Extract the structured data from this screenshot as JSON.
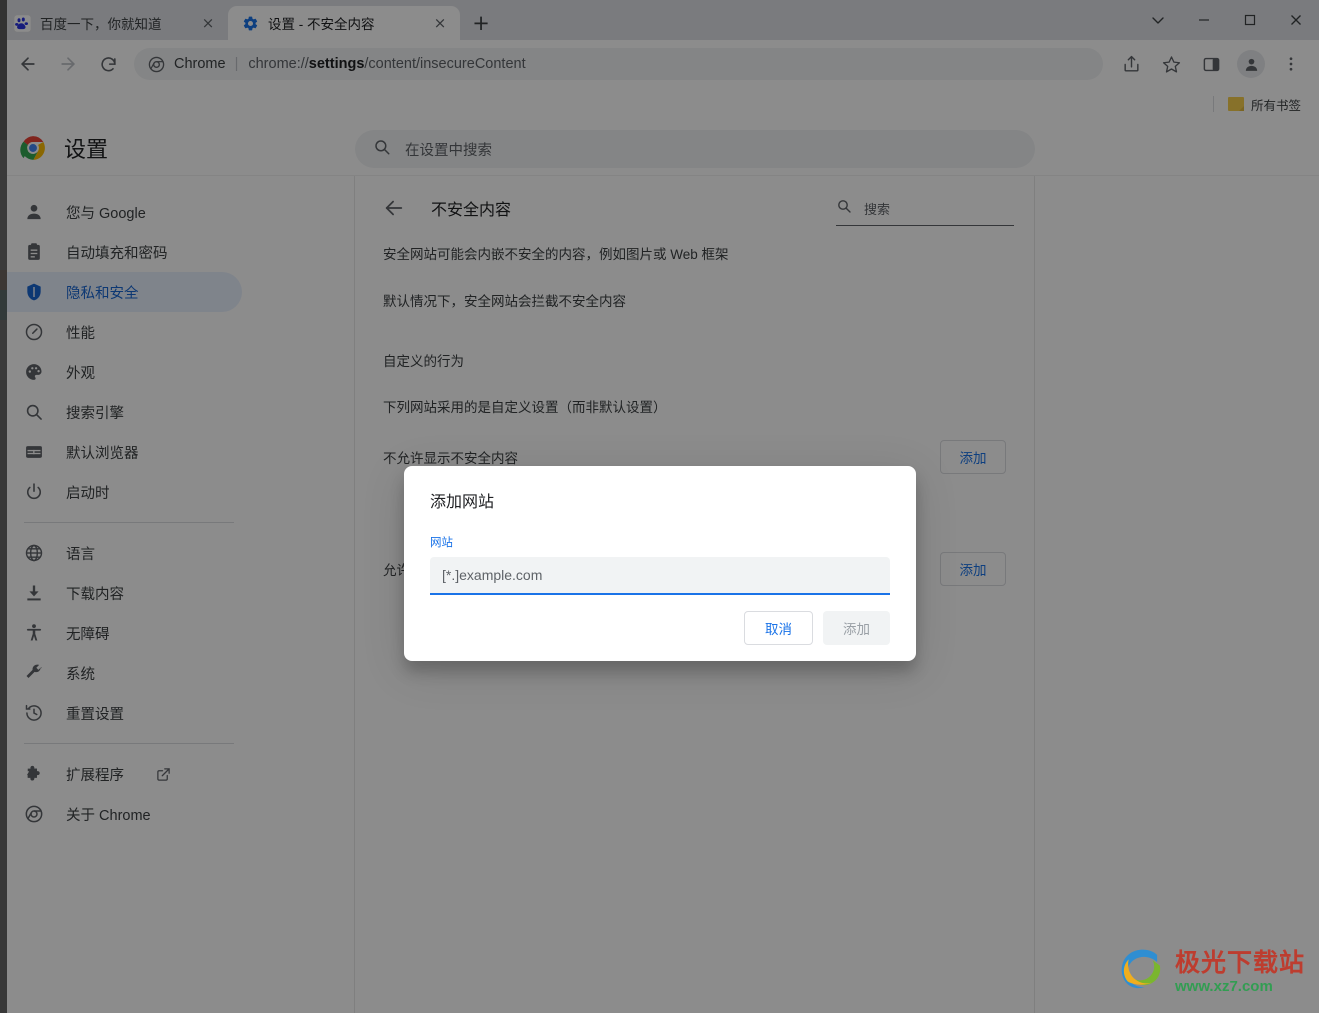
{
  "window": {
    "controls": [
      {
        "name": "tab-search",
        "glyph": "chevron-down"
      },
      {
        "name": "minimize",
        "glyph": "minimize"
      },
      {
        "name": "maximize",
        "glyph": "maximize"
      },
      {
        "name": "close",
        "glyph": "close"
      }
    ]
  },
  "tabs": [
    {
      "title": "百度一下，你就知道",
      "active": false,
      "favicon": "baidu-paw-icon",
      "close_label": "×"
    },
    {
      "title": "设置 - 不安全内容",
      "active": true,
      "favicon": "settings-gear-icon",
      "close_label": "×"
    }
  ],
  "newtab_label": "+",
  "toolbar": {
    "back_icon": "back-arrow-icon",
    "forward_icon": "forward-arrow-icon",
    "reload_icon": "reload-icon",
    "omnibox": {
      "scheme_label": "Chrome",
      "separator": "|",
      "url_prefix": "chrome://",
      "url_bold": "settings",
      "url_suffix": "/content/insecureContent",
      "full_url": "chrome://settings/content/insecureContent"
    },
    "share_icon": "share-icon",
    "bookmark_icon": "bookmark-star-icon",
    "sidepanel_icon": "side-panel-icon",
    "profile_icon": "profile-avatar-icon",
    "menu_icon": "three-dot-menu-icon"
  },
  "bookmarks_bar": {
    "all_bookmarks_label": "所有书签",
    "folder_icon": "folder-icon"
  },
  "settings": {
    "logo": "chrome-logo-icon",
    "title": "设置",
    "search_placeholder": "在设置中搜索",
    "search_icon": "search-icon"
  },
  "sidebar": {
    "items": [
      {
        "label": "您与 Google",
        "icon": "person-icon",
        "selected": false
      },
      {
        "label": "自动填充和密码",
        "icon": "clipboard-icon",
        "selected": false
      },
      {
        "label": "隐私和安全",
        "icon": "shield-icon",
        "selected": true
      },
      {
        "label": "性能",
        "icon": "speedometer-icon",
        "selected": false
      },
      {
        "label": "外观",
        "icon": "palette-icon",
        "selected": false
      },
      {
        "label": "搜索引擎",
        "icon": "magnifier-icon",
        "selected": false
      },
      {
        "label": "默认浏览器",
        "icon": "browser-window-icon",
        "selected": false
      },
      {
        "label": "启动时",
        "icon": "power-icon",
        "selected": false
      }
    ],
    "items2": [
      {
        "label": "语言",
        "icon": "globe-icon",
        "selected": false
      },
      {
        "label": "下载内容",
        "icon": "download-icon",
        "selected": false
      },
      {
        "label": "无障碍",
        "icon": "accessibility-icon",
        "selected": false
      },
      {
        "label": "系统",
        "icon": "wrench-icon",
        "selected": false
      },
      {
        "label": "重置设置",
        "icon": "history-restore-icon",
        "selected": false
      }
    ],
    "items3": [
      {
        "label": "扩展程序",
        "icon": "puzzle-icon",
        "external": true
      },
      {
        "label": "关于 Chrome",
        "icon": "chrome-circle-icon",
        "external": false
      }
    ]
  },
  "content": {
    "back_icon": "back-arrow-icon",
    "title": "不安全内容",
    "search_icon": "search-icon",
    "search_placeholder": "搜索",
    "desc1": "安全网站可能会内嵌不安全的内容，例如图片或 Web 框架",
    "desc2": "默认情况下，安全网站会拦截不安全内容",
    "custom_behavior_title": "自定义的行为",
    "custom_behavior_sub": "下列网站采用的是自定义设置（而非默认设置）",
    "rows": [
      {
        "label": "不允许显示不安全内容",
        "button": "添加"
      },
      {
        "label": "允许显示不安全内容",
        "button": "添加"
      }
    ]
  },
  "dialog": {
    "title": "添加网站",
    "field_label": "网站",
    "input_value": "",
    "input_placeholder": "[*.]example.com",
    "cancel_label": "取消",
    "add_label": "添加"
  },
  "watermark": {
    "main": "极光下载站",
    "sub": "www.xz7.com",
    "icon": "aurora-swirl-logo"
  },
  "colors": {
    "accent_blue": "#1a73e8",
    "selected_nav_bg": "#e8f0fe",
    "selected_nav_text": "#1967d2",
    "toolbar_bg": "#ffffff",
    "tabstrip_bg": "#dee1e6",
    "scrim": "rgba(0,0,0,0.45)"
  }
}
